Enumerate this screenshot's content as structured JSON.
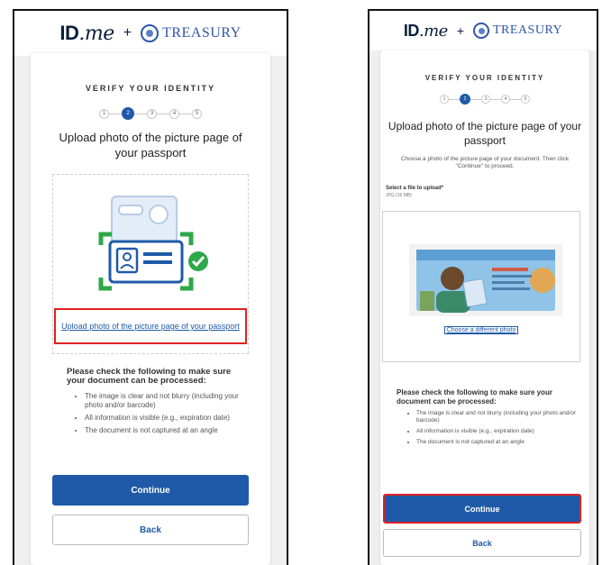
{
  "colors": {
    "brand_blue": "#1f5aa8",
    "navy": "#0b1f3a",
    "highlight_red": "#e02020",
    "success_green": "#2ea84a",
    "background": "#efefef"
  },
  "icons": [
    "treasury-seal-icon",
    "id-card-scan-icon",
    "checkmark-icon",
    "passport-preview-image"
  ],
  "left_screen": {
    "brand": {
      "logo_id": "ID",
      "logo_me": ".me",
      "plus": "+",
      "partner": "TREASURY"
    },
    "step_title": "VERIFY YOUR IDENTITY",
    "steps": [
      "1",
      "2",
      "3",
      "4",
      "5"
    ],
    "active_step": 2,
    "heading": "Upload photo of the picture page of your passport",
    "upload_link": "Upload photo of the picture page of your passport",
    "checklist_title": "Please check the following to make sure your document can be processed:",
    "checklist": [
      "The image is clear and not blurry (including your photo and/or barcode)",
      "All information is visible (e.g., expiration date)",
      "The document is not captured at an angle"
    ],
    "continue_label": "Continue",
    "back_label": "Back"
  },
  "right_screen": {
    "brand": {
      "logo_id": "ID",
      "logo_me": ".me",
      "plus": "+",
      "partner": "TREASURY"
    },
    "step_title": "VERIFY YOUR IDENTITY",
    "steps": [
      "1",
      "2",
      "3",
      "4",
      "5"
    ],
    "active_step": 2,
    "heading": "Upload photo of the picture page of your passport",
    "subtext": "Choose a photo of the picture page of your document. Then click \"Continue\" to proceed.",
    "file_label": "Select a file to upload*",
    "file_hint": "JPG (16 MB)",
    "change_link": "Choose a different photo",
    "checklist_title": "Please check the following to make sure your document can be processed:",
    "checklist": [
      "The image is clear and not blurry (including your photo and/or barcode)",
      "All information is visible (e.g., expiration date)",
      "The document is not captured at an angle"
    ],
    "continue_label": "Continue",
    "back_label": "Back"
  }
}
